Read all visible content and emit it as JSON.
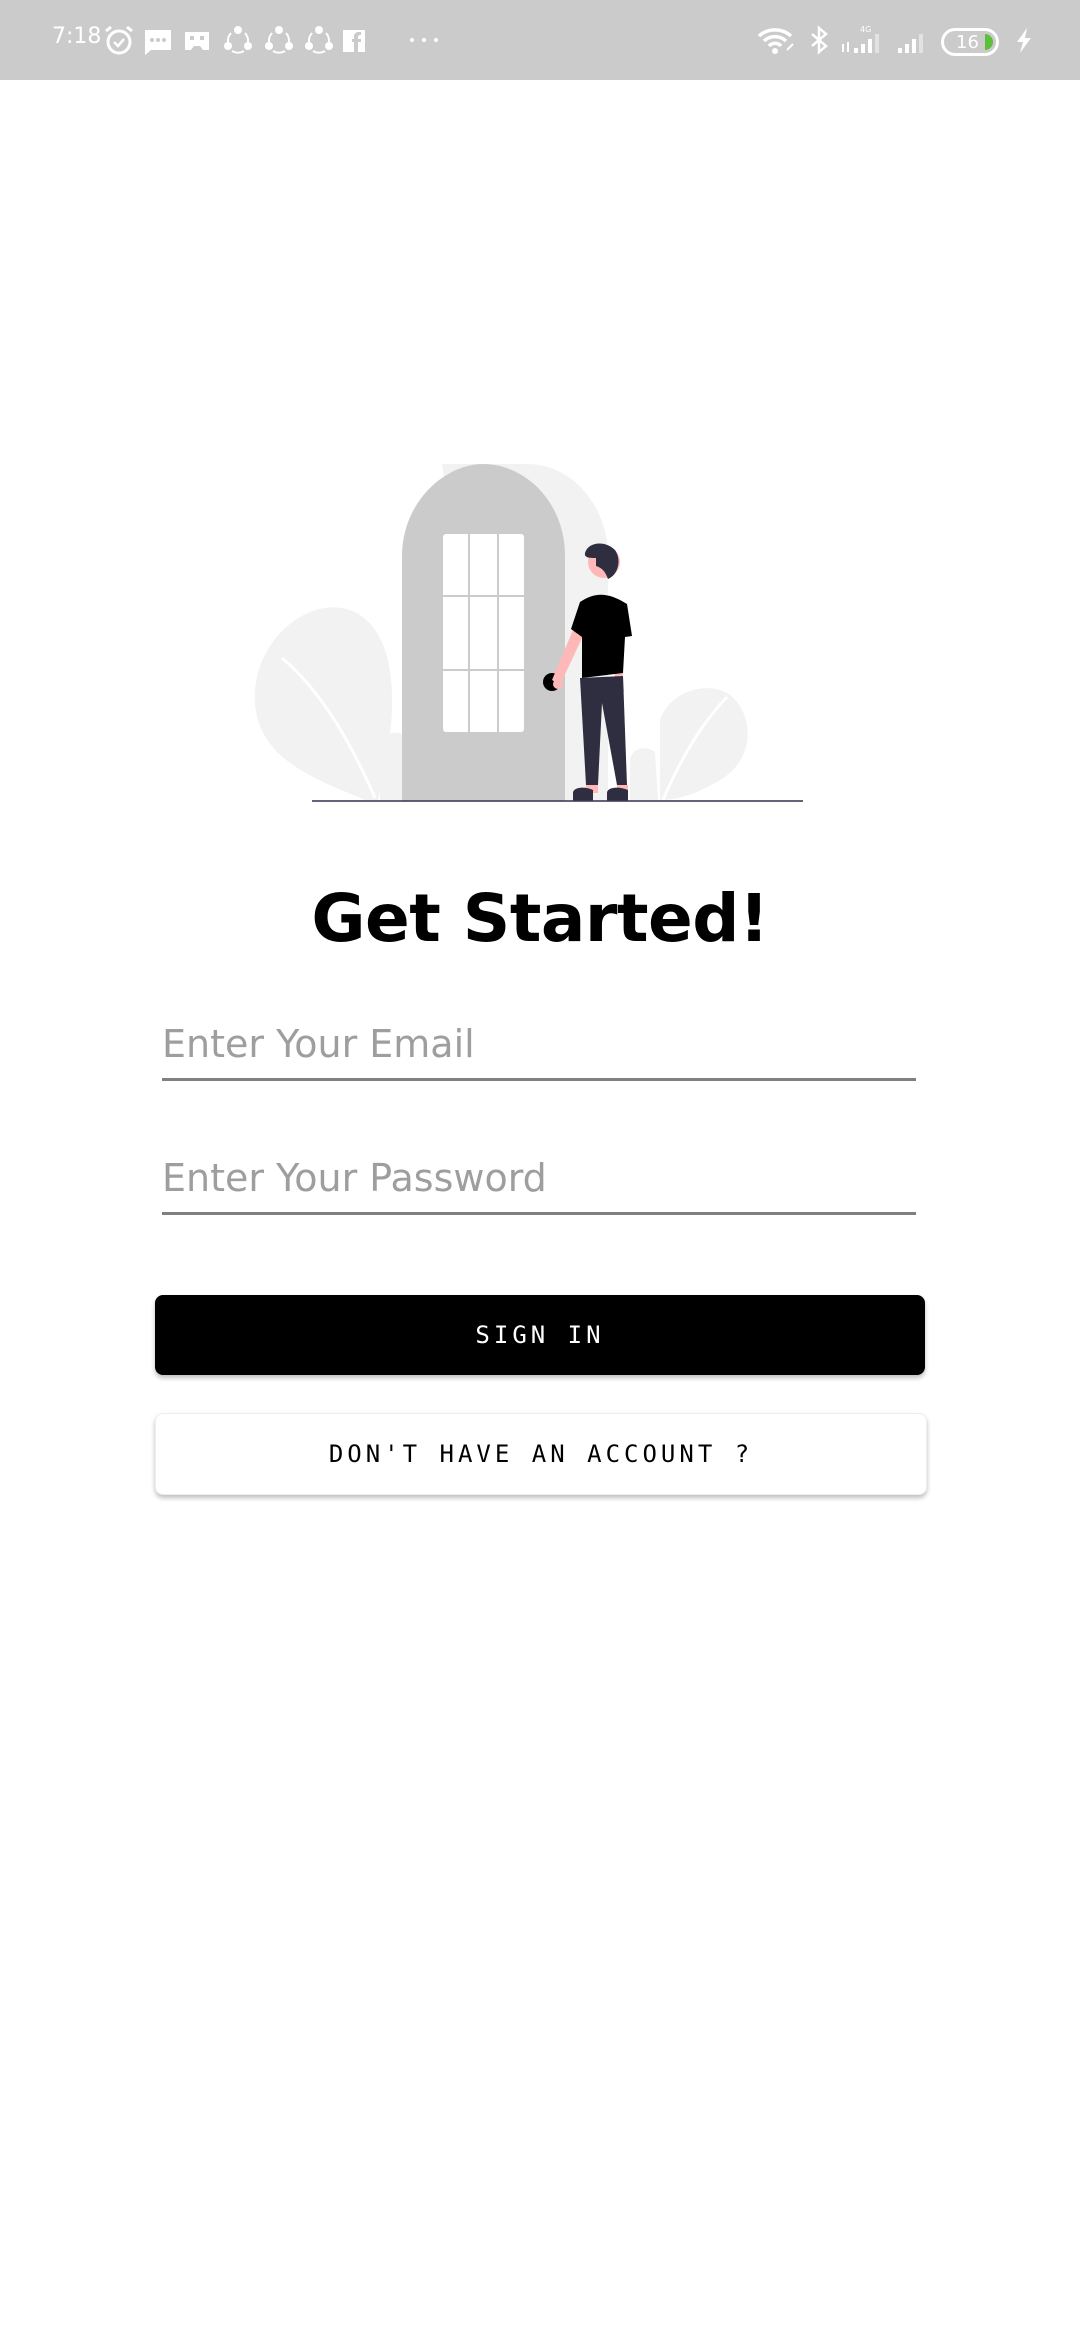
{
  "status_bar": {
    "time": "7:18",
    "left_icons": [
      "alarm-icon",
      "message-icon",
      "game-controller-icon",
      "share-icon",
      "share-icon",
      "share-icon",
      "facebook-icon",
      "more-notifications-icon"
    ],
    "right_icons": [
      "wifi-icon",
      "bluetooth-icon",
      "signal-4g-icon",
      "signal-icon",
      "battery-icon",
      "charging-icon"
    ],
    "network_label": "4G",
    "battery_level": "16",
    "battery_color": "#5cc03a"
  },
  "illustration": {
    "description": "person standing next to arched door",
    "colors": {
      "door": "#cbcbcb",
      "door_shadow": "#f2f2f2",
      "plants": "#f2f2f2",
      "shirt": "#000000",
      "pants": "#2f2e41",
      "skin": "#ffb8b8",
      "ground": "#3f3d56"
    }
  },
  "main": {
    "title": "Get Started!",
    "email_placeholder": "Enter Your Email",
    "email_value": "",
    "password_placeholder": "Enter Your Password",
    "password_value": "",
    "sign_in_label": "SIGN IN",
    "register_label": "DON'T HAVE AN ACCOUNT ?"
  }
}
